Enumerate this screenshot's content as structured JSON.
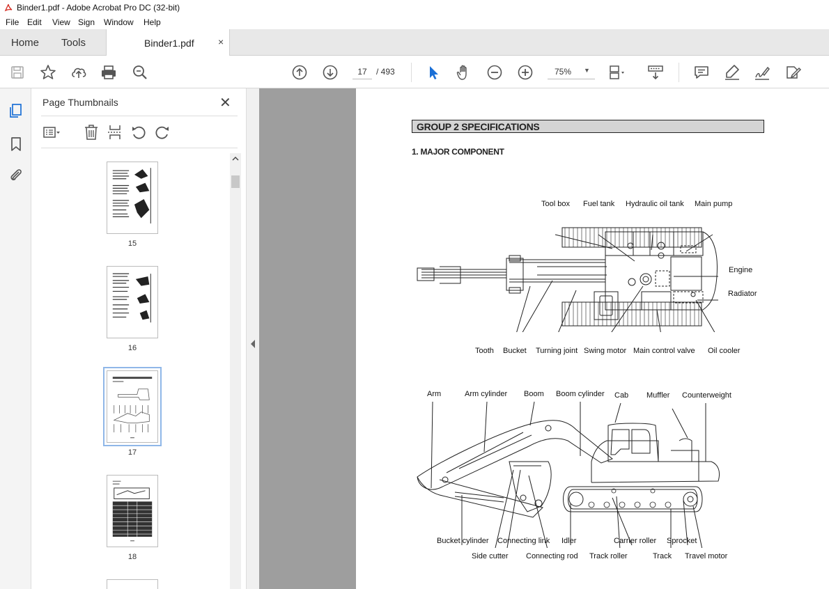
{
  "window": {
    "title": "Binder1.pdf - Adobe Acrobat Pro DC (32-bit)"
  },
  "menu": [
    "File",
    "Edit",
    "View",
    "Sign",
    "Window",
    "Help"
  ],
  "tabs": {
    "home": "Home",
    "tools": "Tools",
    "document": "Binder1.pdf",
    "close": "×"
  },
  "toolbar": {
    "current_page": "17",
    "total_pages": "/ 493",
    "zoom": "75%",
    "icons": [
      "save-icon",
      "star-icon",
      "upload-icon",
      "print-icon",
      "zoom-search-icon",
      "page-up-icon",
      "page-down-icon",
      "select-cursor-icon",
      "hand-icon",
      "zoom-out-icon",
      "zoom-in-icon",
      "fit-page-icon",
      "scroll-mode-icon",
      "comment-icon",
      "highlight-icon",
      "sign-icon",
      "fill-sign-icon"
    ]
  },
  "sidebar": {
    "title": "Page Thumbnails",
    "close": "✕",
    "thumbnails": [
      {
        "label": "15"
      },
      {
        "label": "16"
      },
      {
        "label": "17",
        "selected": true
      },
      {
        "label": "18"
      }
    ]
  },
  "document": {
    "group_header": "GROUP 2 SPECIFICATIONS",
    "section_title": "1. MAJOR COMPONENT",
    "top_view_labels": {
      "tool_box": "Tool box",
      "fuel_tank": "Fuel tank",
      "hydraulic_oil_tank": "Hydraulic oil tank",
      "main_pump": "Main pump",
      "engine": "Engine",
      "radiator": "Radiator",
      "tooth": "Tooth",
      "bucket": "Bucket",
      "turning_joint": "Turning joint",
      "swing_motor": "Swing motor",
      "main_control_valve": "Main control valve",
      "oil_cooler": "Oil cooler"
    },
    "side_view_labels": {
      "arm": "Arm",
      "arm_cylinder": "Arm cylinder",
      "boom": "Boom",
      "boom_cylinder": "Boom cylinder",
      "cab": "Cab",
      "muffler": "Muffler",
      "counterweight": "Counterweight",
      "bucket_cylinder": "Bucket cylinder",
      "connecting_link": "Connecting link",
      "idler": "Idler",
      "carrier_roller": "Carrier roller",
      "sprocket": "Sprocket",
      "side_cutter": "Side cutter",
      "connecting_rod": "Connecting rod",
      "track_roller": "Track roller",
      "track": "Track",
      "travel_motor": "Travel motor"
    }
  }
}
